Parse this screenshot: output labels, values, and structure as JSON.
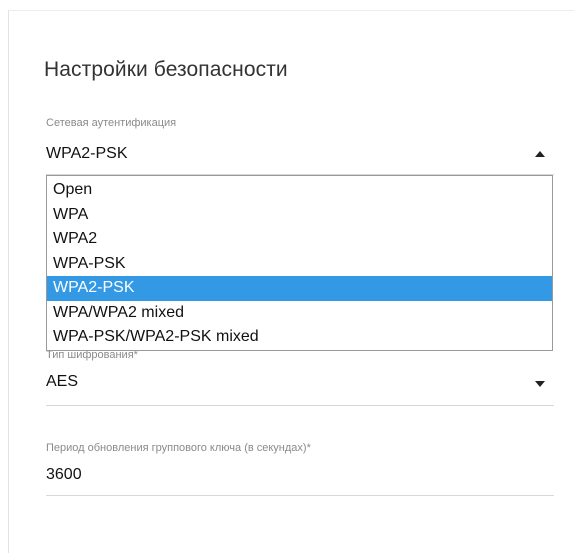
{
  "section_title": "Настройки безопасности",
  "auth": {
    "label": "Сетевая аутентификация",
    "value": "WPA2-PSK",
    "options": [
      "Open",
      "WPA",
      "WPA2",
      "WPA-PSK",
      "WPA2-PSK",
      "WPA/WPA2 mixed",
      "WPA-PSK/WPA2-PSK mixed"
    ],
    "selected_index": 4,
    "caret_icon": "caret-up-icon"
  },
  "encryption": {
    "label": "Тип шифрования*",
    "value": "AES",
    "caret_icon": "caret-down-icon"
  },
  "group_key": {
    "label": "Период обновления группового ключа (в секундах)*",
    "value": "3600"
  },
  "colors": {
    "selected_option": "#3399e5",
    "label": "#8a8a8a"
  }
}
